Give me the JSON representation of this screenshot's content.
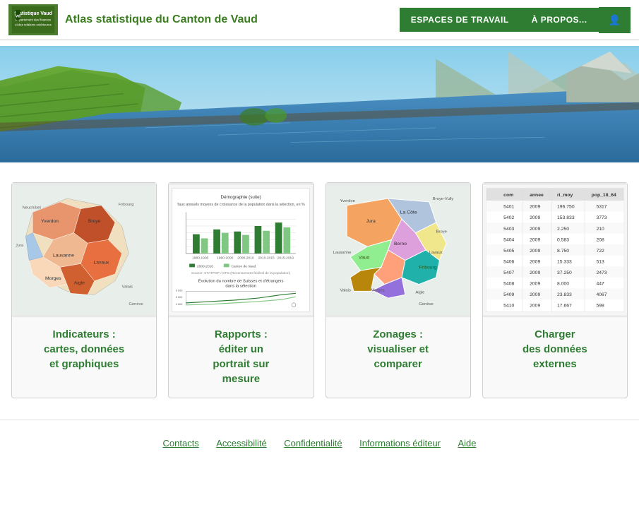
{
  "header": {
    "logo_line1": "Statistique Vaud",
    "logo_line2": "Département des finances",
    "logo_line3": "et des relations extérieures",
    "site_title": "Atlas statistique du Canton de Vaud",
    "nav_items": [
      {
        "label": "ESPACES DE TRAVAIL",
        "id": "espaces-de-travail"
      },
      {
        "label": "À PROPOS...",
        "id": "a-propos"
      },
      {
        "label": "👤",
        "id": "user-icon"
      }
    ]
  },
  "cards": [
    {
      "id": "indicateurs",
      "label": "Indicateurs :\ncartes, données\net graphiques",
      "label_html": "Indicateurs :<br>cartes, données<br>et graphiques"
    },
    {
      "id": "rapports",
      "label": "Rapports :\néditer un\nportrait sur\nmesure",
      "label_html": "Rapports :<br>éditer un<br>portrait sur<br>mesure"
    },
    {
      "id": "zonages",
      "label": "Zonages :\nvisualiser et\ncomparer",
      "label_html": "Zonages :<br>visualiser et<br>comparer"
    },
    {
      "id": "charger",
      "label": "Charger\ndes données\nexternes",
      "label_html": "Charger<br>des données<br>externes"
    }
  ],
  "footer": {
    "links": [
      {
        "label": "Contacts",
        "id": "contacts"
      },
      {
        "label": "Accessibilité",
        "id": "accessibilite"
      },
      {
        "label": "Confidentialité",
        "id": "confidentialite"
      },
      {
        "label": "Informations éditeur",
        "id": "informations-editeur"
      },
      {
        "label": "Aide",
        "id": "aide"
      }
    ]
  }
}
